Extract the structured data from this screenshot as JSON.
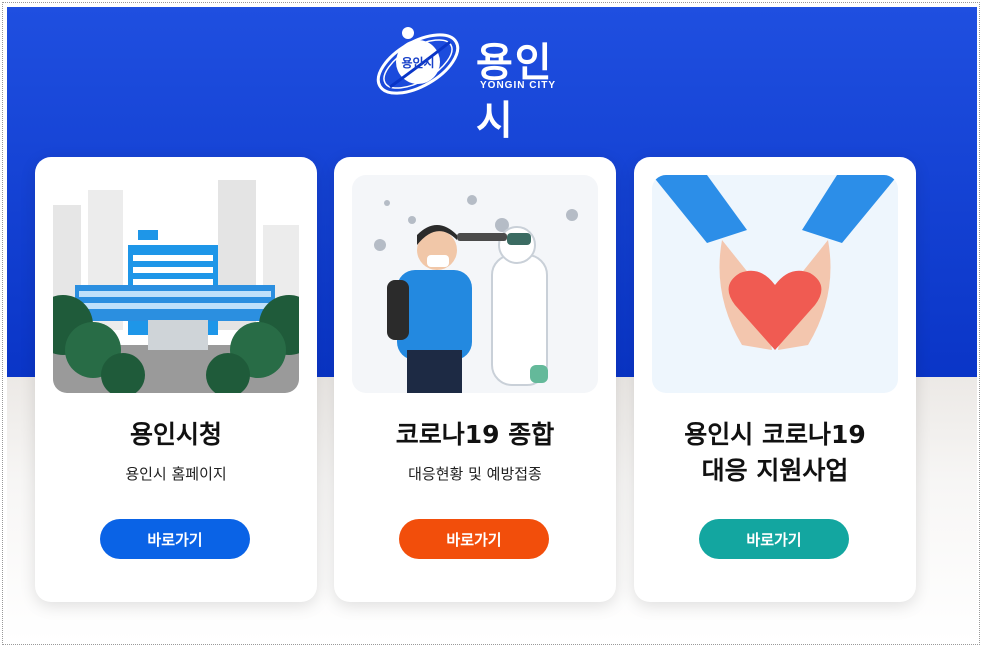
{
  "logo": {
    "emblem_text": "용인시",
    "name": "용인시",
    "sub": "YONGIN CITY"
  },
  "cards": [
    {
      "title_line1": "용인시청",
      "title_line2": "",
      "subtitle": "용인시 홈페이지",
      "button": "바로가기",
      "button_color": "#0a63e6"
    },
    {
      "title_line1": "코로나19 종합",
      "title_line2": "",
      "subtitle": "대응현황 및 예방접종",
      "button": "바로가기",
      "button_color": "#f24e0b"
    },
    {
      "title_line1": "용인시 코로나19",
      "title_line2": "대응 지원사업",
      "subtitle": "",
      "button": "바로가기",
      "button_color": "#13a6a0"
    }
  ],
  "colors": {
    "hero": "#0a35c7"
  },
  "icons": [
    "city-hall-illustration",
    "covid-temperature-check-illustration",
    "heart-hands-illustration"
  ]
}
